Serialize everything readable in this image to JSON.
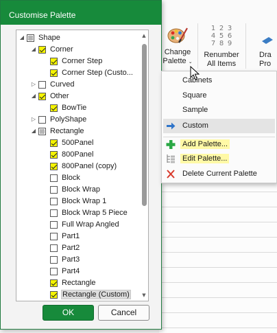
{
  "dialog": {
    "title": "Customise Palette",
    "ok_label": "OK",
    "cancel_label": "Cancel",
    "tree": [
      {
        "label": "Shape",
        "indent": 0,
        "expander": "expanded",
        "check": "partial"
      },
      {
        "label": "Corner",
        "indent": 1,
        "expander": "expanded",
        "check": "checked"
      },
      {
        "label": "Corner Step",
        "indent": 2,
        "expander": "none",
        "check": "checked"
      },
      {
        "label": "Corner Step (Custo...",
        "indent": 2,
        "expander": "none",
        "check": "checked"
      },
      {
        "label": "Curved",
        "indent": 1,
        "expander": "collapsed",
        "check": "unchecked"
      },
      {
        "label": "Other",
        "indent": 1,
        "expander": "expanded",
        "check": "checked"
      },
      {
        "label": "BowTie",
        "indent": 2,
        "expander": "none",
        "check": "checked"
      },
      {
        "label": "PolyShape",
        "indent": 1,
        "expander": "collapsed",
        "check": "unchecked"
      },
      {
        "label": "Rectangle",
        "indent": 1,
        "expander": "expanded",
        "check": "partial"
      },
      {
        "label": "500Panel",
        "indent": 2,
        "expander": "none",
        "check": "checked"
      },
      {
        "label": "800Panel",
        "indent": 2,
        "expander": "none",
        "check": "checked"
      },
      {
        "label": "800Panel (copy)",
        "indent": 2,
        "expander": "none",
        "check": "checked"
      },
      {
        "label": "Block",
        "indent": 2,
        "expander": "none",
        "check": "unchecked"
      },
      {
        "label": "Block Wrap",
        "indent": 2,
        "expander": "none",
        "check": "unchecked"
      },
      {
        "label": "Block Wrap 1",
        "indent": 2,
        "expander": "none",
        "check": "unchecked"
      },
      {
        "label": "Block Wrap 5 Piece",
        "indent": 2,
        "expander": "none",
        "check": "unchecked"
      },
      {
        "label": "Full Wrap Angled",
        "indent": 2,
        "expander": "none",
        "check": "unchecked"
      },
      {
        "label": "Part1",
        "indent": 2,
        "expander": "none",
        "check": "unchecked"
      },
      {
        "label": "Part2",
        "indent": 2,
        "expander": "none",
        "check": "unchecked"
      },
      {
        "label": "Part3",
        "indent": 2,
        "expander": "none",
        "check": "unchecked"
      },
      {
        "label": "Part4",
        "indent": 2,
        "expander": "none",
        "check": "unchecked"
      },
      {
        "label": "Rectangle",
        "indent": 2,
        "expander": "none",
        "check": "checked"
      },
      {
        "label": "Rectangle (Custom)",
        "indent": 2,
        "expander": "none",
        "check": "checked",
        "selected": true
      }
    ]
  },
  "ribbon": {
    "change_palette_line1": "Change",
    "change_palette_line2": "Palette",
    "renumber_line1": "Renumber",
    "renumber_line2": "All Items",
    "renumber_digits": [
      "1",
      "2",
      "3",
      "4",
      "5",
      "6",
      "7",
      "8",
      "9"
    ],
    "draw_line1": "Dra",
    "draw_line2": "Pro"
  },
  "menu": {
    "items": [
      {
        "label": "Cabinets",
        "icon": null
      },
      {
        "label": "Square",
        "icon": null
      },
      {
        "label": "Sample",
        "icon": null
      },
      {
        "label": "Custom",
        "icon": "arrow-right-icon",
        "selected": true
      },
      {
        "label": "Add Palette...",
        "icon": "plus-icon",
        "highlight": true
      },
      {
        "label": "Edit Palette...",
        "icon": "tree-list-icon",
        "highlight": true
      },
      {
        "label": "Delete Current Palette",
        "icon": "delete-x-icon"
      }
    ]
  },
  "colors": {
    "accent": "#178a3b",
    "checkbox_fill": "#f5f400",
    "highlight": "#fff9a6"
  }
}
